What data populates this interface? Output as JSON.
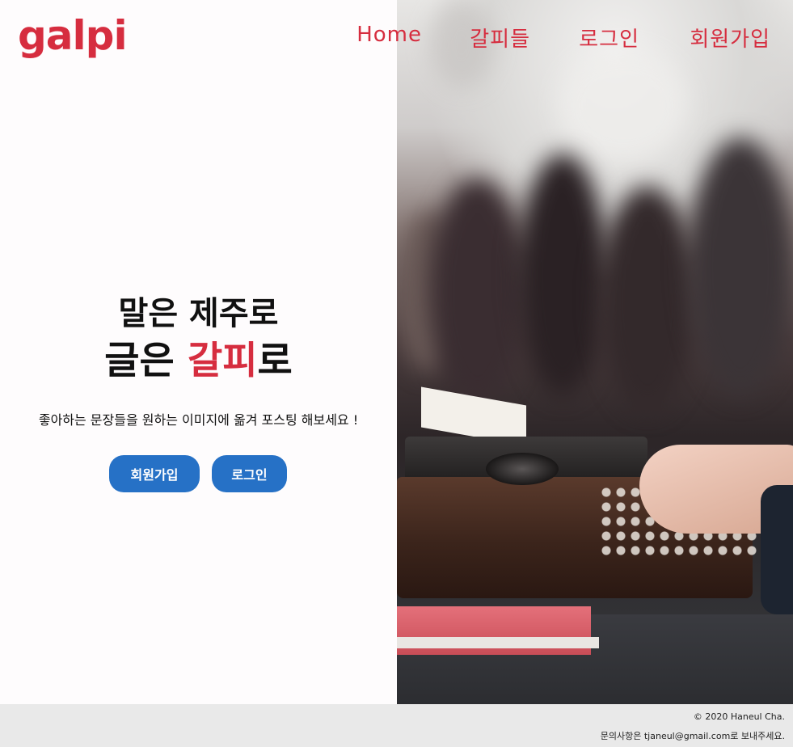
{
  "header": {
    "logo": "galpi",
    "nav": [
      "Home",
      "갈피들",
      "로그인",
      "회원가입"
    ]
  },
  "hero": {
    "line1": "말은 제주로",
    "line2_prefix": "글은 ",
    "line2_accent": "갈피",
    "line2_suffix": "로",
    "subtitle": "좋아하는 문장들을 원하는 이미지에 옮겨 포스팅 해보세요 !",
    "signup_button": "회원가입",
    "login_button": "로그인"
  },
  "footer": {
    "copyright": "© 2020 Haneul Cha.",
    "contact": "문의사항은 tjaneul@gmail.com로 보내주세요."
  },
  "colors": {
    "accent": "#d62d3f",
    "button": "#2671c6",
    "footer_bg": "#e9e9e9"
  },
  "icons": [
    "typewriter-photo"
  ]
}
